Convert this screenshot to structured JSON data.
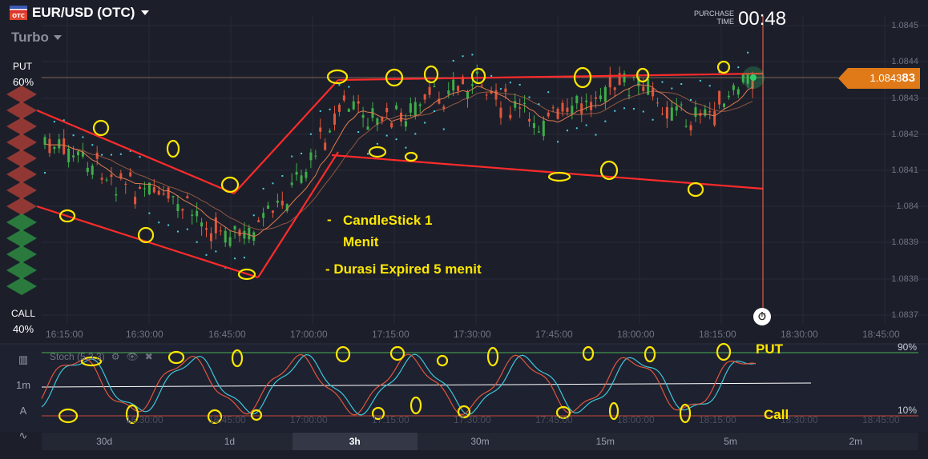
{
  "header": {
    "flag_badge": "OTC",
    "symbol": "EUR/USD (OTC)",
    "mode": "Turbo",
    "purchase_label_1": "PURCHASE",
    "purchase_label_2": "TIME",
    "purchase_time": "00:48"
  },
  "sentiment": {
    "put_label": "PUT",
    "put_pct": "60%",
    "call_label": "CALL",
    "call_pct": "40%",
    "put_value": 60,
    "call_value": 40
  },
  "price_tag": {
    "main": "1.0843",
    "last_digits": "83"
  },
  "y_axis": [
    "1.0845",
    "1.0844",
    "1.0843",
    "1.0842",
    "1.0841",
    "1.084",
    "1.0839",
    "1.0838",
    "1.0837"
  ],
  "x_axis": [
    "16:15:00",
    "16:30:00",
    "16:45:00",
    "17:00:00",
    "17:15:00",
    "17:30:00",
    "17:45:00",
    "18:00:00",
    "18:15:00",
    "18:30:00",
    "18:45:00"
  ],
  "annotations": {
    "line1_dash": "-",
    "line1": "CandleStick 1",
    "line2": "Menit",
    "line3": "- Durasi Expired 5 menit"
  },
  "indicator": {
    "name": "Stoch (5,3,3)",
    "gear": "⚙",
    "eye": "👁",
    "close": "✖",
    "level_high": "90%",
    "level_low": "10%",
    "put_text": "PUT",
    "call_text": "Call"
  },
  "tools": {
    "candles": "▥",
    "interval": "1m",
    "draw": "A",
    "indicators": "∿"
  },
  "timeframes": [
    {
      "label": "30d",
      "active": false
    },
    {
      "label": "1d",
      "active": false
    },
    {
      "label": "3h",
      "active": true
    },
    {
      "label": "30m",
      "active": false
    },
    {
      "label": "15m",
      "active": false
    },
    {
      "label": "5m",
      "active": false
    },
    {
      "label": "2m",
      "active": false
    }
  ],
  "colors": {
    "background": "#1c1f2a",
    "bull": "#3fae49",
    "bear": "#e0563c",
    "annotation_red": "#ff2b2b",
    "annotation_yellow": "#ffe700",
    "price_tag": "#e07a18",
    "psar": "#4dd0e1",
    "ma": "#e07a50"
  },
  "timer_icon": "⏱"
}
